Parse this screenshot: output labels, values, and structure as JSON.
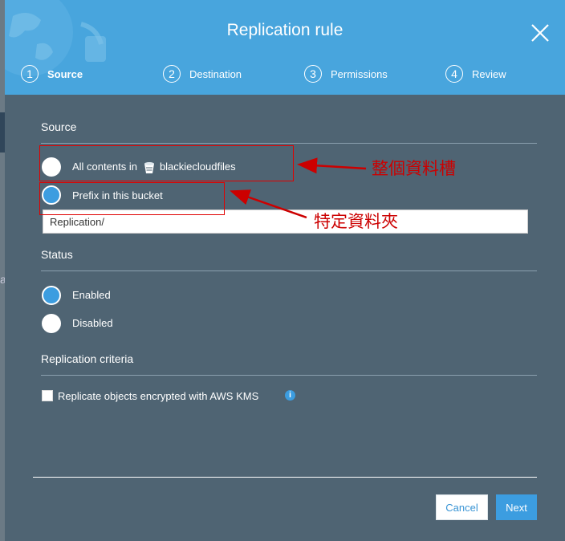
{
  "modal": {
    "title": "Replication rule",
    "close_icon": "close-icon"
  },
  "steps": [
    {
      "number": "1",
      "label": "Source",
      "active": true
    },
    {
      "number": "2",
      "label": "Destination",
      "active": false
    },
    {
      "number": "3",
      "label": "Permissions",
      "active": false
    },
    {
      "number": "4",
      "label": "Review",
      "active": false
    }
  ],
  "source": {
    "section_title": "Source",
    "option_all_prefix": "All contents in",
    "bucket_name": "blackiecloudfiles",
    "option_prefix": "Prefix in this bucket",
    "selected": "prefix",
    "prefix_value": "Replication/"
  },
  "status": {
    "section_title": "Status",
    "option_enabled": "Enabled",
    "option_disabled": "Disabled",
    "selected": "enabled"
  },
  "criteria": {
    "section_title": "Replication criteria",
    "kms_label": "Replicate objects encrypted with AWS KMS",
    "kms_checked": false
  },
  "footer": {
    "cancel_label": "Cancel",
    "next_label": "Next"
  },
  "annotations": {
    "whole_bucket": "整個資料槽",
    "specific_folder": "特定資料夾"
  },
  "backdrop": {
    "partial_text": "a"
  },
  "colors": {
    "header": "#48a5dd",
    "body": "#4f6473",
    "accent": "#3c9de0",
    "annotation": "#e00000"
  }
}
